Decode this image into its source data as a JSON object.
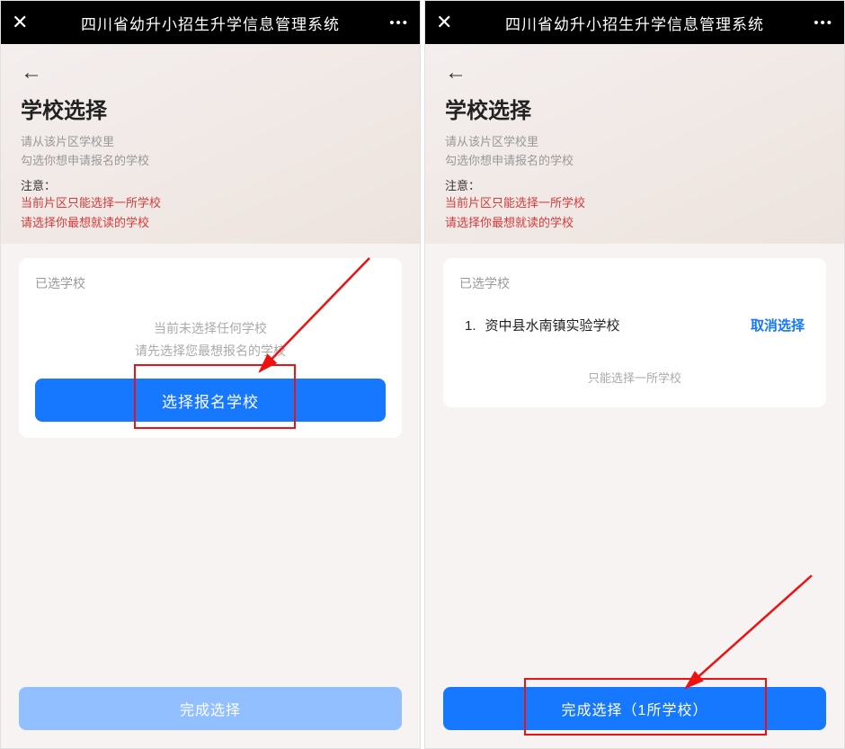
{
  "header": {
    "app_title": "四川省幼升小招生升学信息管理系统"
  },
  "page": {
    "title": "学校选择",
    "subtitle_line1": "请从该片区学校里",
    "subtitle_line2": "勾选你想申请报名的学校",
    "notice_label": "注意：",
    "warning_line1": "当前片区只能选择一所学校",
    "warning_line2": "请选择你最想就读的学校"
  },
  "left": {
    "card_label": "已选学校",
    "empty_line1": "当前未选择任何学校",
    "empty_line2": "请先选择您最想报名的学校",
    "select_button": "选择报名学校",
    "complete_button": "完成选择"
  },
  "right": {
    "card_label": "已选学校",
    "selected_index": "1.",
    "selected_school": "资中县水南镇实验学校",
    "cancel_label": "取消选择",
    "limit_note": "只能选择一所学校",
    "complete_button": "完成选择（1所学校）"
  }
}
